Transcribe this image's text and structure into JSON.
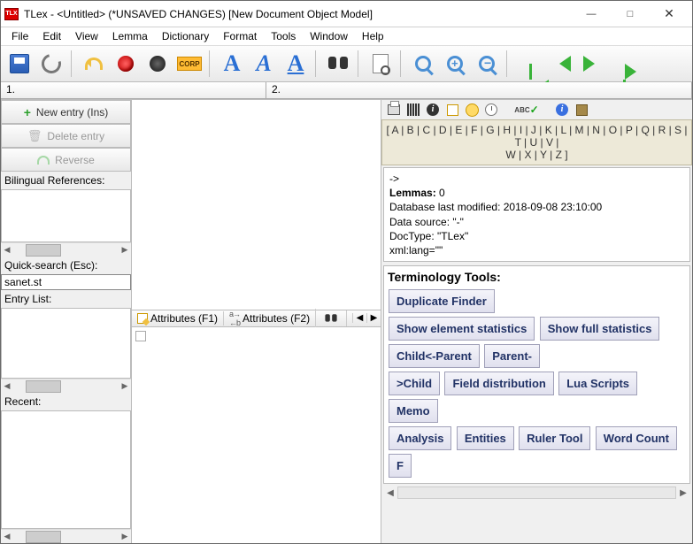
{
  "window": {
    "title": "TLex - <Untitled> (*UNSAVED CHANGES) [New Document Object Model]",
    "app_icon_text": "TLX"
  },
  "menu": [
    "File",
    "Edit",
    "View",
    "Lemma",
    "Dictionary",
    "Format",
    "Tools",
    "Window",
    "Help"
  ],
  "toolbar_corp": "CORP",
  "numstrip": {
    "cell1": "1.",
    "cell2": "2."
  },
  "left": {
    "new_entry": "New entry (Ins)",
    "delete_entry": "Delete entry",
    "reverse": "Reverse",
    "biling_label": "Bilingual References:",
    "quick_label": "Quick-search (Esc):",
    "quick_value": "sanet.st",
    "entry_list_label": "Entry List:",
    "recent_label": "Recent:"
  },
  "attr": {
    "tab1": "Attributes (F1)",
    "tab2": "Attributes (F2)"
  },
  "alpha": {
    "row1": "[ A | B | C | D | E | F | G | H | I | J | K | L | M | N | O | P | Q | R | S | T | U | V |",
    "row2": "W | X | Y | Z ]"
  },
  "info": {
    "arrow": "->",
    "lemmas_label": "Lemmas:",
    "lemmas_count": "0",
    "db_modified": "Database last modified: 2018-09-08 23:10:00",
    "data_source": "Data source: \"-\"",
    "doc_type": "DocType: \"TLex\"",
    "xml_lang": "xml:lang=\"\""
  },
  "tools": {
    "title": "Terminology Tools:",
    "btns": [
      "Duplicate Finder",
      "Show element statistics",
      "Show full statistics",
      "Child<-Parent",
      "Parent-",
      ">Child",
      "Field distribution",
      "Lua Scripts",
      "Memo",
      "Analysis",
      "Entities",
      "Ruler Tool",
      "Word Count",
      "F"
    ]
  }
}
